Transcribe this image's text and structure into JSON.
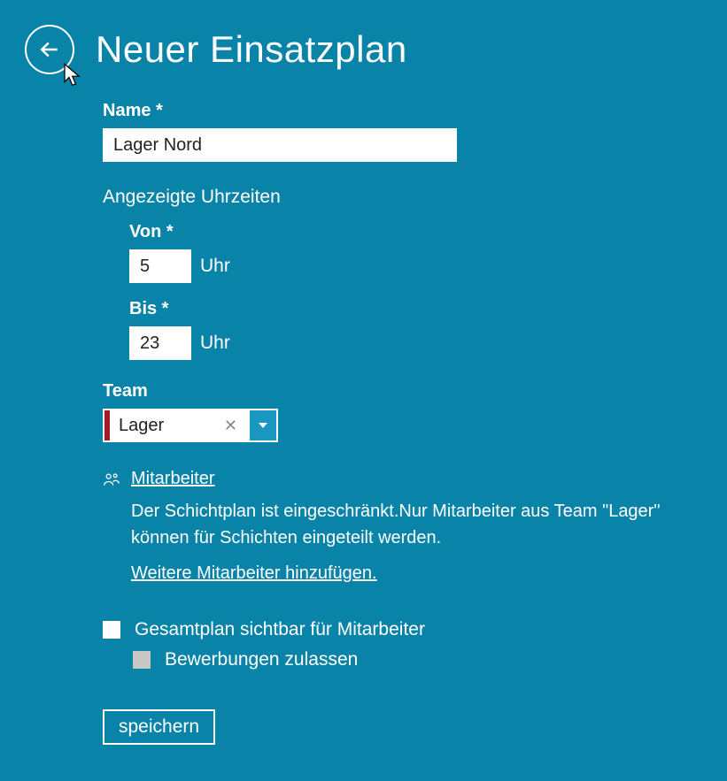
{
  "header": {
    "title": "Neuer Einsatzplan"
  },
  "form": {
    "name": {
      "label": "Name *",
      "value": "Lager Nord"
    },
    "times": {
      "heading": "Angezeigte Uhrzeiten",
      "from": {
        "label": "Von *",
        "value": "5",
        "unit": "Uhr"
      },
      "to": {
        "label": "Bis *",
        "value": "23",
        "unit": "Uhr"
      }
    },
    "team": {
      "label": "Team",
      "value": "Lager"
    },
    "mitarbeiter": {
      "link_label": "Mitarbeiter",
      "info": "Der Schichtplan ist eingeschränkt.Nur Mitarbeiter aus Team \"Lager\" können für Schichten eingeteilt werden.",
      "add_link": "Weitere Mitarbeiter hinzufügen."
    },
    "checkboxes": {
      "visible": {
        "label": "Gesamtplan sichtbar für Mitarbeiter",
        "checked": false
      },
      "applications": {
        "label": "Bewerbungen zulassen",
        "checked": false,
        "disabled": true
      }
    },
    "save_label": "speichern"
  }
}
